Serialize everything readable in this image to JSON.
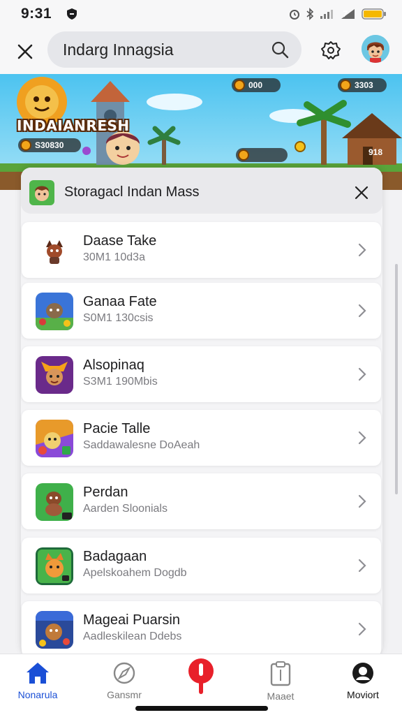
{
  "status_bar": {
    "time": "9:31"
  },
  "header": {
    "search_text": "Indarg Innagsia",
    "close_icon": "close-icon",
    "search_icon": "search-icon",
    "settings_icon": "gear-icon"
  },
  "banner": {
    "title": "INDAIANRESH",
    "stat_left": "S30830",
    "stat_top_mid": "000",
    "stat_top_right": "3303",
    "stat_bottom_mid": "",
    "stat_bottom_right": "918"
  },
  "sheet": {
    "title": "Storagacl Indan Mass"
  },
  "games": [
    {
      "title": "Daase Take",
      "subtitle": "30M1 10d3a"
    },
    {
      "title": "Ganaa Fate",
      "subtitle": "S0M1 130csis"
    },
    {
      "title": "Alsopinaq",
      "subtitle": "S3M1 190Mbis"
    },
    {
      "title": "Pacie Talle",
      "subtitle": "Saddawalesne DoAeah"
    },
    {
      "title": "Perdan",
      "subtitle": "Aarden Sloonials"
    },
    {
      "title": "Badagaan",
      "subtitle": "Apelskoahem Dogdb"
    },
    {
      "title": "Mageai Puarsin",
      "subtitle": "Aadleskilean Ddebs"
    }
  ],
  "nav": {
    "home": "Nonarula",
    "games": "Gansmr",
    "library": "Maaet",
    "profile": "Moviort"
  },
  "colors": {
    "accent": "#1a4fd6",
    "center_button": "#e8202a",
    "battery": "#f5b800"
  }
}
